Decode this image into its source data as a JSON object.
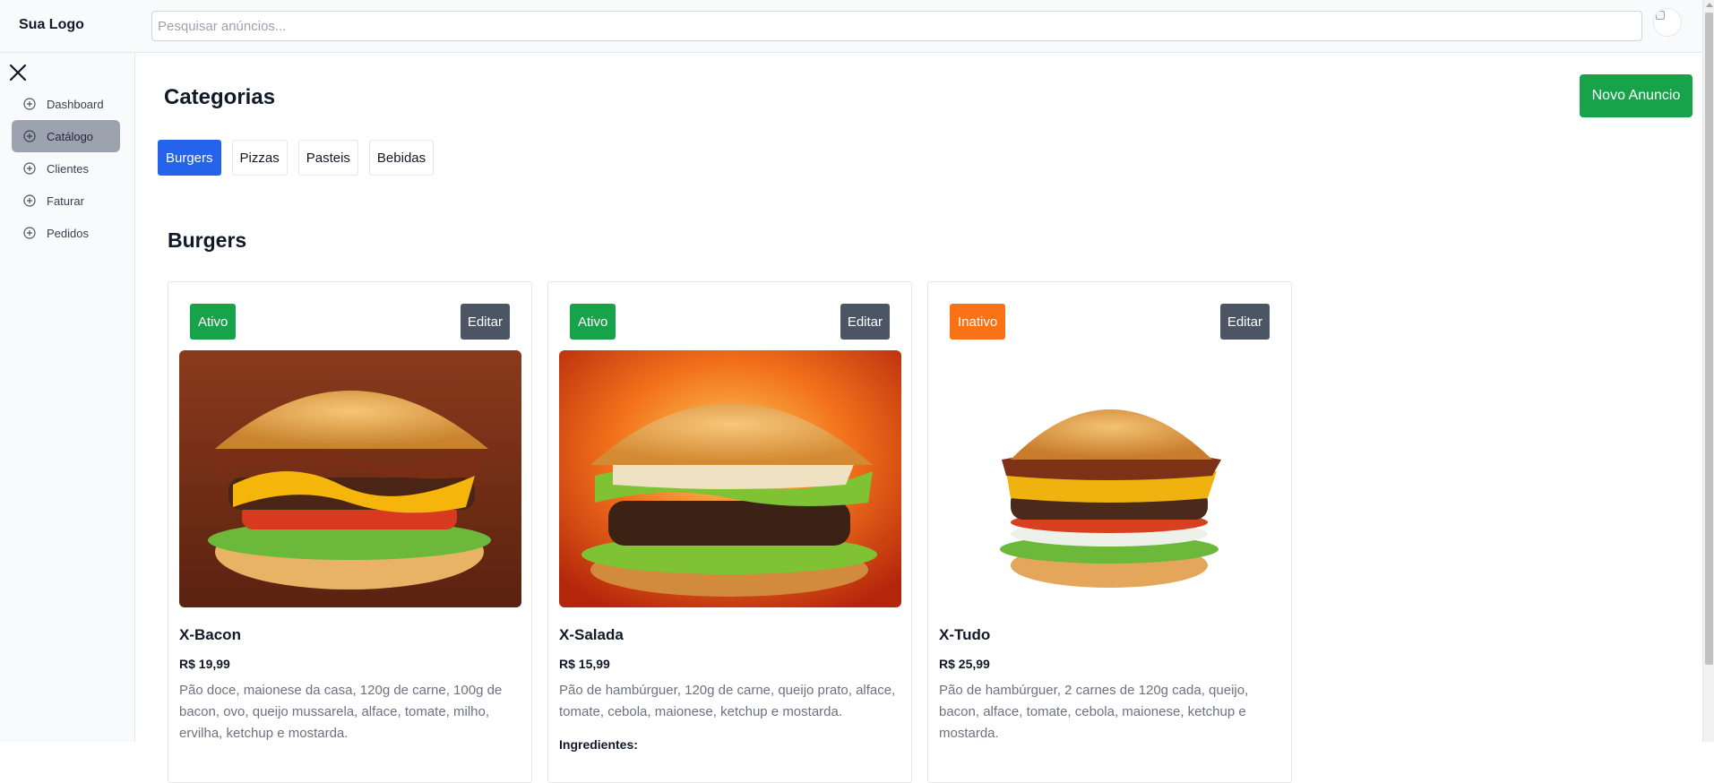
{
  "header": {
    "logo": "Sua Logo",
    "search_placeholder": "Pesquisar anúncios...",
    "avatar_alt": "Avatar"
  },
  "sidebar": {
    "items": [
      {
        "label": "Dashboard",
        "icon": "plus-circle-icon",
        "active": false
      },
      {
        "label": "Catálogo",
        "icon": "plus-circle-icon",
        "active": true
      },
      {
        "label": "Clientes",
        "icon": "plus-circle-icon",
        "active": false
      },
      {
        "label": "Faturar",
        "icon": "plus-circle-icon",
        "active": false
      },
      {
        "label": "Pedidos",
        "icon": "plus-circle-icon",
        "active": false
      }
    ]
  },
  "main": {
    "title": "Categorias",
    "new_button": "Novo Anuncio",
    "tabs": [
      {
        "label": "Burgers",
        "active": true
      },
      {
        "label": "Pizzas",
        "active": false
      },
      {
        "label": "Pasteis",
        "active": false
      },
      {
        "label": "Bebidas",
        "active": false
      }
    ],
    "section_title": "Burgers",
    "cards": [
      {
        "status": "Ativo",
        "status_color": "#16a34a",
        "edit_label": "Editar",
        "name": "X-Bacon",
        "price": "R$ 19,99",
        "description": "Pão doce, maionese da casa, 120g de carne, 100g de bacon, ovo, queijo mussarela, alface, tomate, milho, ervilha, ketchup e mostarda.",
        "extra": "",
        "image": "burger-photo"
      },
      {
        "status": "Ativo",
        "status_color": "#16a34a",
        "edit_label": "Editar",
        "name": "X-Salada",
        "price": "R$ 15,99",
        "description": "Pão de hambúrguer, 120g de carne, queijo prato, alface, tomate, cebola, maionese, ketchup e mostarda.",
        "extra": "Ingredientes:",
        "image": "burger-photo"
      },
      {
        "status": "Inativo",
        "status_color": "#f97316",
        "edit_label": "Editar",
        "name": "X-Tudo",
        "price": "R$ 25,99",
        "description": "Pão de hambúrguer, 2 carnes de 120g cada, queijo, bacon, alface, tomate, cebola, maionese, ketchup e mostarda.",
        "extra": "",
        "image": "burger-photo"
      }
    ]
  }
}
